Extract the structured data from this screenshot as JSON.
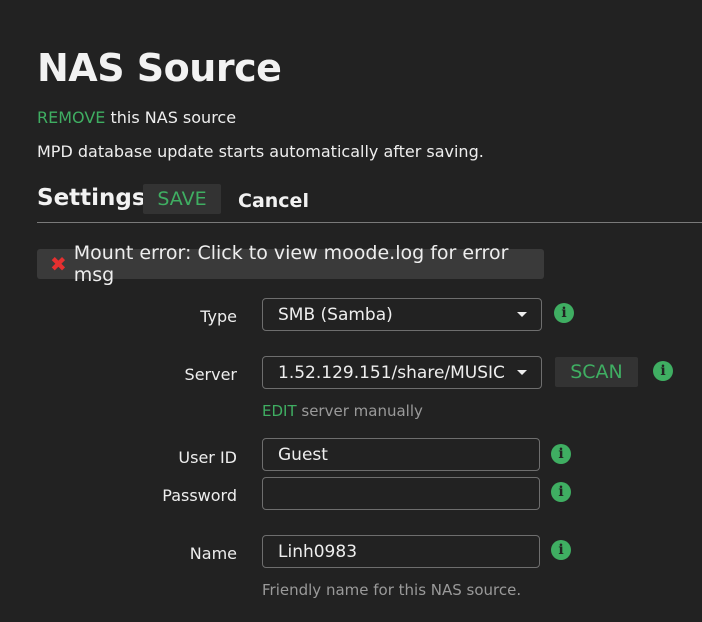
{
  "page": {
    "title": "NAS Source",
    "remove_link": "REMOVE",
    "remove_suffix": " this NAS source",
    "note": "MPD database update starts automatically after saving."
  },
  "settings": {
    "heading": "Settings",
    "save_label": "SAVE",
    "cancel_label": "Cancel"
  },
  "error": {
    "icon": "✖",
    "message": "Mount error: Click to view moode.log for error msg"
  },
  "form": {
    "type": {
      "label": "Type",
      "value": "SMB (Samba)"
    },
    "server": {
      "label": "Server",
      "value": "1.52.129.151/share/MUSIC",
      "scan_label": "SCAN",
      "edit_link": "EDIT",
      "edit_suffix": " server manually"
    },
    "userid": {
      "label": "User ID",
      "value": "Guest"
    },
    "password": {
      "label": "Password",
      "value": ""
    },
    "name": {
      "label": "Name",
      "value": "Linh0983",
      "hint": "Friendly name for this NAS source."
    },
    "info_glyph": "i"
  },
  "colors": {
    "background": "#222222",
    "accent_green": "#3fae62",
    "error_red": "#e53030",
    "button_bg": "#333333"
  }
}
